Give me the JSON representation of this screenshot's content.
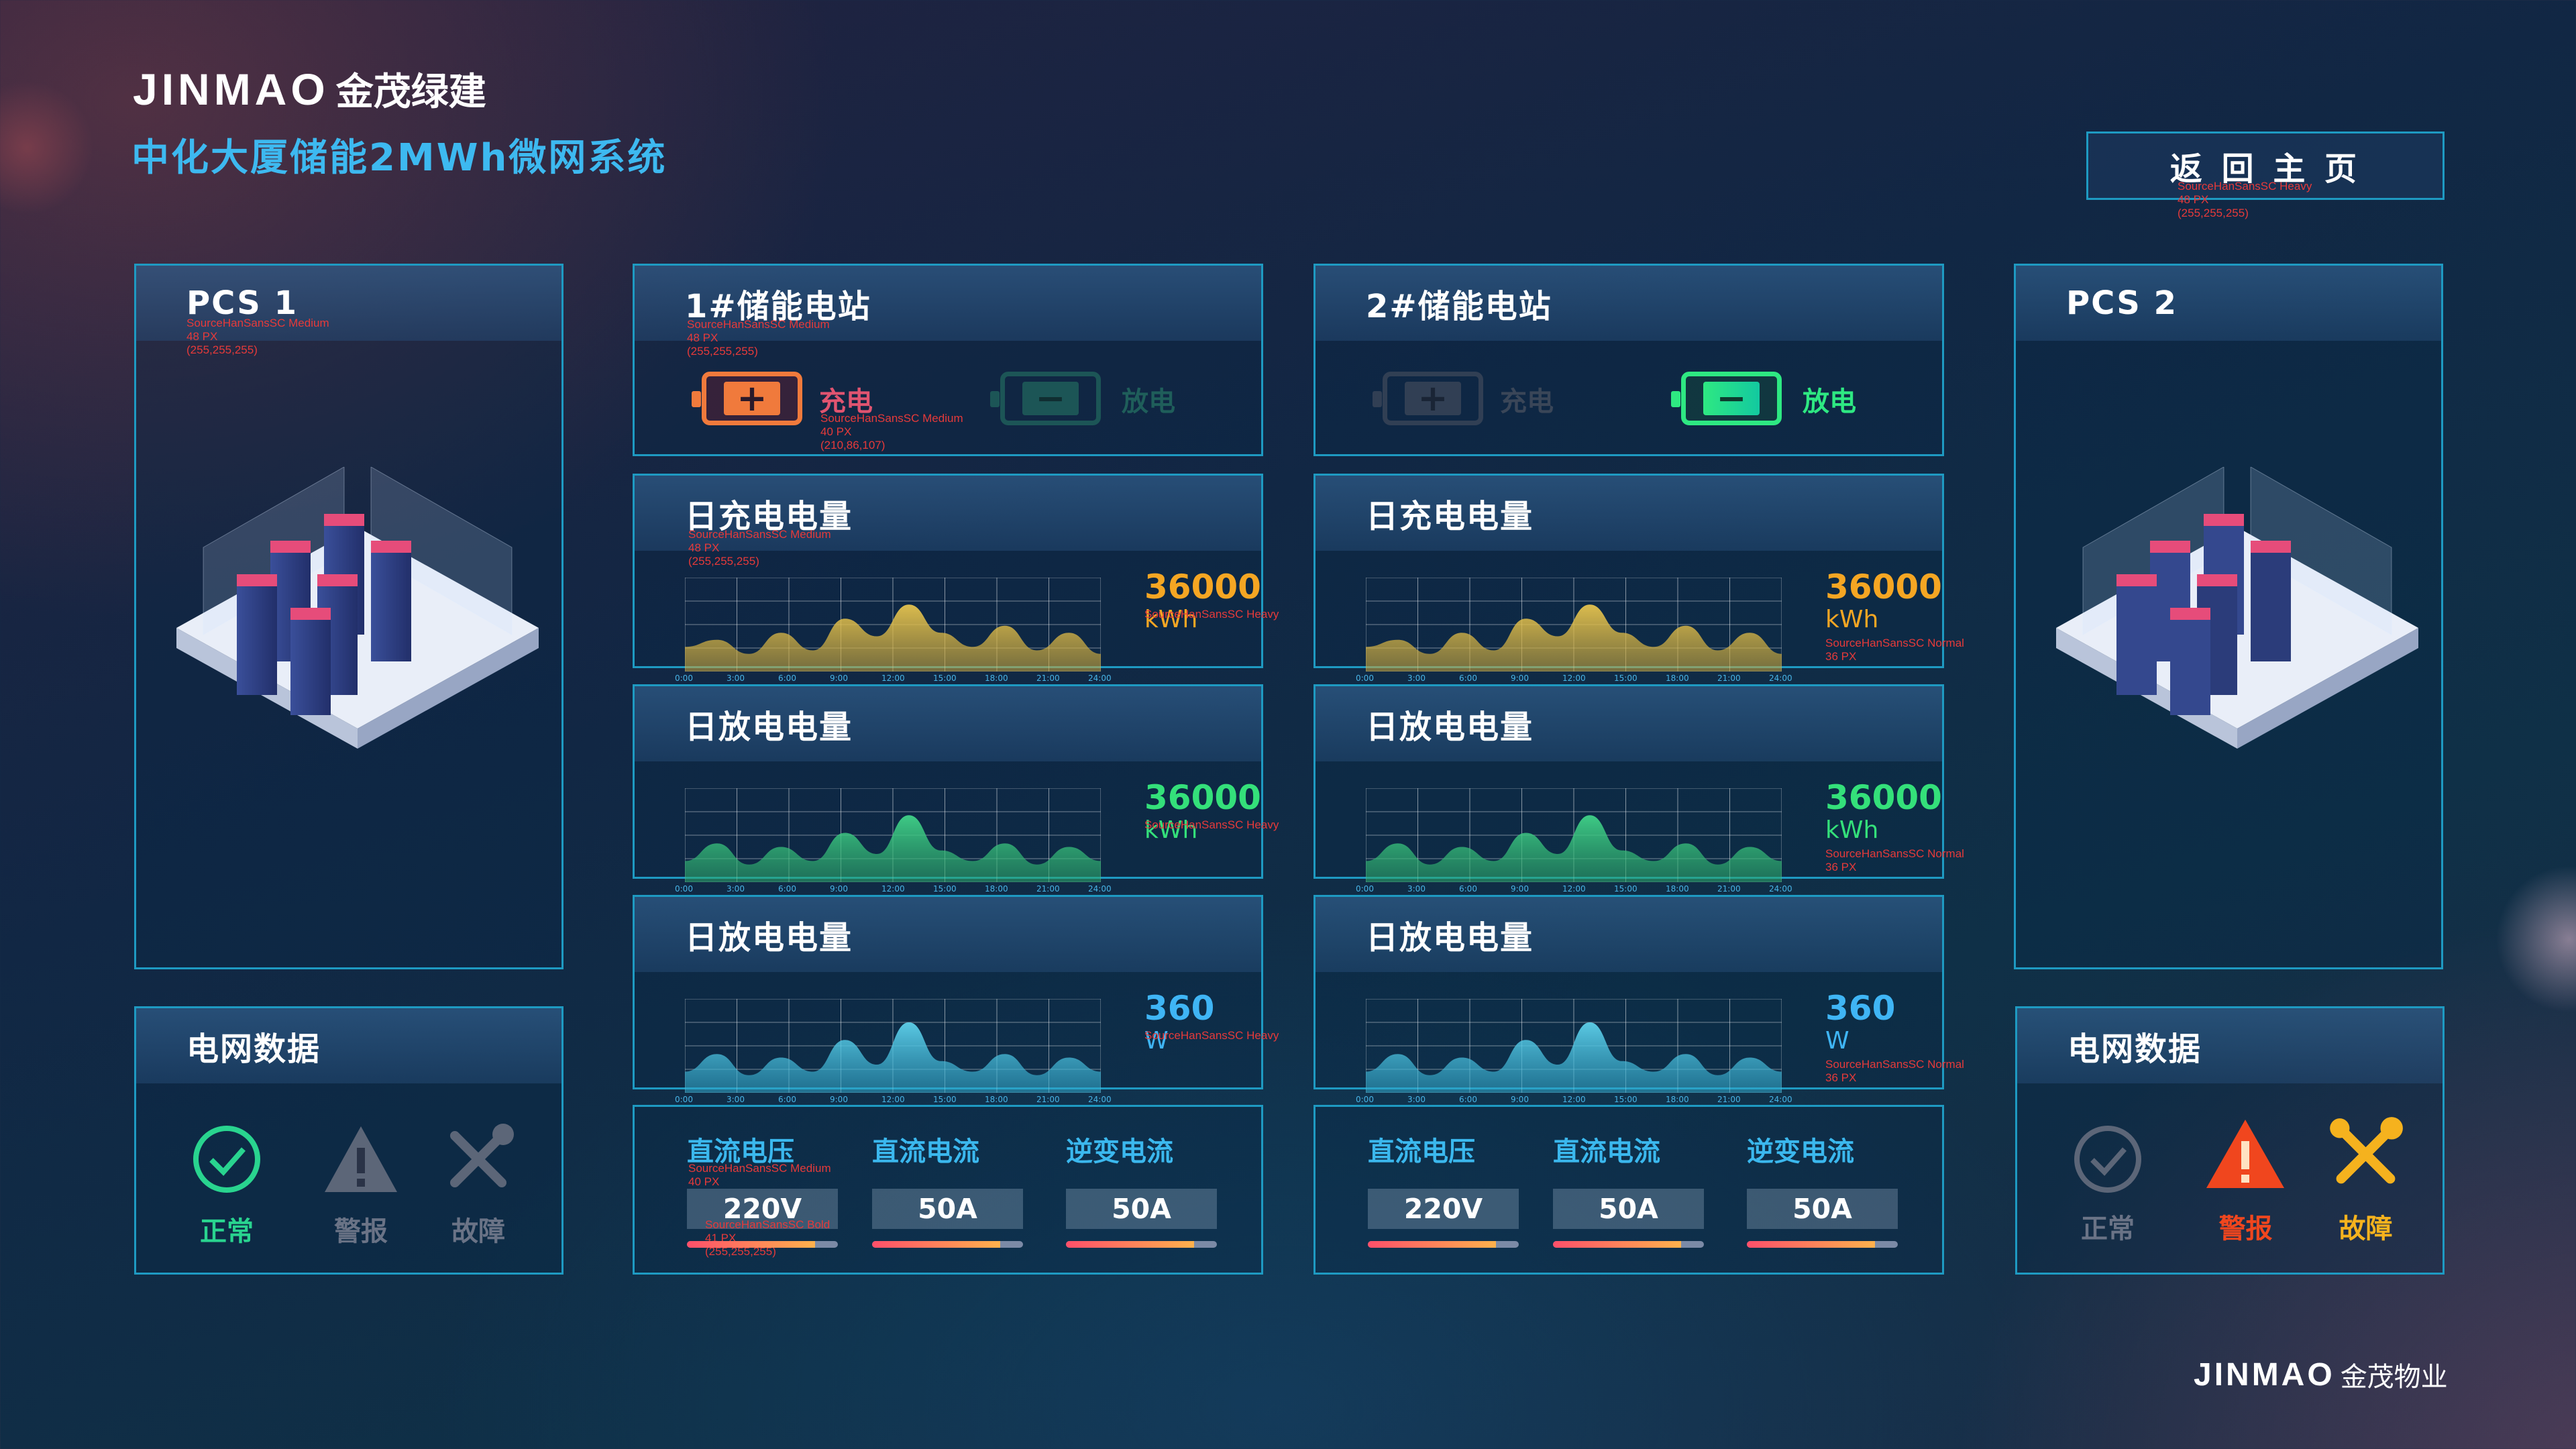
{
  "brand": {
    "logo": "JINMAO",
    "logo_cn": "金茂绿建",
    "subtitle": "中化大厦储能2MWh微网系统",
    "footer_logo": "JINMAO",
    "footer_cn": "金茂物业"
  },
  "home_button": {
    "label": "返 回 主 页",
    "ann": "SourceHanSansSC Heavy\n48 PX\n(255,255,255)"
  },
  "pcs1": {
    "title": "PCS 1",
    "ann": "SourceHanSansSC Medium\n48 PX\n(255,255,255)"
  },
  "pcs2": {
    "title": "PCS 2"
  },
  "grid_left": {
    "title": "电网数据",
    "normal": "正常",
    "warning": "警报",
    "fault": "故障"
  },
  "grid_right": {
    "title": "电网数据",
    "normal": "正常",
    "warning": "警报",
    "fault": "故障"
  },
  "station1": {
    "title": "1#储能电站",
    "ann": "SourceHanSansSC Medium\n48 PX\n(255,255,255)",
    "charge": "充电",
    "charge_ann": "SourceHanSansSC Medium\n40 PX\n(210,86,107)",
    "discharge": "放电"
  },
  "station2": {
    "title": "2#储能电站",
    "charge": "充电",
    "discharge": "放电"
  },
  "time_ticks": [
    "0:00",
    "3:00",
    "6:00",
    "9:00",
    "12:00",
    "15:00",
    "18:00",
    "21:00",
    "24:00"
  ],
  "s1_chart1": {
    "title": "日充电电量",
    "value": "36000",
    "unit": "kWh",
    "title_ann": "SourceHanSansSC Medium\n48 PX\n(255,255,255)",
    "value_ann": "SourceHanSansSC Heavy"
  },
  "s1_chart2": {
    "title": "日放电电量",
    "value": "36000",
    "unit": "kWh",
    "value_ann": "SourceHanSansSC Heavy"
  },
  "s1_chart3": {
    "title": "日放电电量",
    "value": "360",
    "unit": "W",
    "value_ann": "SourceHanSansSC Heavy"
  },
  "s2_chart1": {
    "title": "日充电电量",
    "value": "36000",
    "unit": "kWh",
    "unit_ann": "SourceHanSansSC Normal\n36 PX"
  },
  "s2_chart2": {
    "title": "日放电电量",
    "value": "36000",
    "unit": "kWh",
    "unit_ann": "SourceHanSansSC Normal\n36 PX"
  },
  "s2_chart3": {
    "title": "日放电电量",
    "value": "360",
    "unit": "W",
    "unit_ann": "SourceHanSansSC Normal\n36 PX"
  },
  "s1_elec": {
    "dc_voltage": "直流电压",
    "dc_current": "直流电流",
    "inverter_current": "逆变电流",
    "v_dc": "220V",
    "i_dc": "50A",
    "i_inv": "50A",
    "label_ann": "SourceHanSansSC Medium\n40 PX",
    "value_ann": "SourceHanSansSC Bold\n41 PX\n(255,255,255)",
    "bar_levels": [
      0.85,
      0.85,
      0.85
    ]
  },
  "s2_elec": {
    "dc_voltage": "直流电压",
    "dc_current": "直流电流",
    "inverter_current": "逆变电流",
    "v_dc": "220V",
    "i_dc": "50A",
    "i_inv": "50A",
    "bar_levels": [
      0.85,
      0.85,
      0.85
    ]
  },
  "colors": {
    "charge_line": "#e6c44f",
    "discharge_line": "#41d389",
    "power_line": "#3cc2e6",
    "charge_value": "#f5a623",
    "discharge_value": "#34e07a",
    "power_value": "#3fb5f5",
    "border": "#1e9ac2"
  },
  "icons": [
    "check-circle-icon",
    "warning-triangle-icon",
    "tools-icon",
    "server-rack-icon",
    "battery-plus-icon",
    "battery-minus-icon"
  ]
}
